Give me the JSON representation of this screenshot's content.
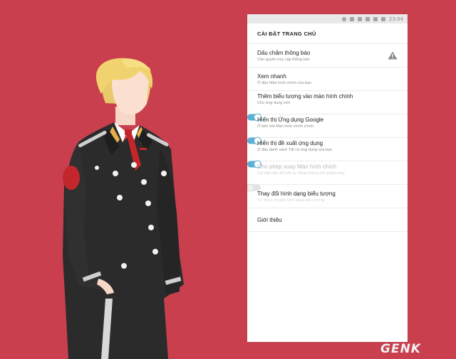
{
  "statusbar": {
    "time": "23:04"
  },
  "screen": {
    "title": "CÀI ĐẶT TRANG CHỦ",
    "items": [
      {
        "title": "Dấu chấm thông báo",
        "subtitle": "Cần quyền truy cập thông báo",
        "trailing": "warning-icon"
      },
      {
        "title": "Xem nhanh",
        "subtitle": "Ở đầu Màn hình chính của bạn"
      },
      {
        "title": "Thêm biểu tượng vào màn hình chính",
        "subtitle": "Cho ứng dụng mới",
        "toggle": "on"
      },
      {
        "title": "Hiển thị Ứng dụng Google",
        "subtitle": "Ở bên trái Màn hình chính chính",
        "toggle": "on"
      },
      {
        "title": "Hiển thị đề xuất ứng dụng",
        "subtitle": "Ở đầu danh sách Tất cả ứng dụng của bạn",
        "toggle": "on"
      },
      {
        "title": "Cho phép xoay Màn hình chính",
        "subtitle": "Cài đặt Hiển thị trên tự động không cho phép xoay",
        "toggle": "off",
        "disabled": true
      },
      {
        "title": "Thay đổi hình dạng biểu tượng",
        "subtitle": "Tự động chuyển hình dạng biểu tượng"
      },
      {
        "title": "Giới thiệu"
      }
    ]
  },
  "watermark": {
    "text": "GENK"
  },
  "colors": {
    "background": "#c93f4e",
    "accent": "#5ab0d5"
  }
}
